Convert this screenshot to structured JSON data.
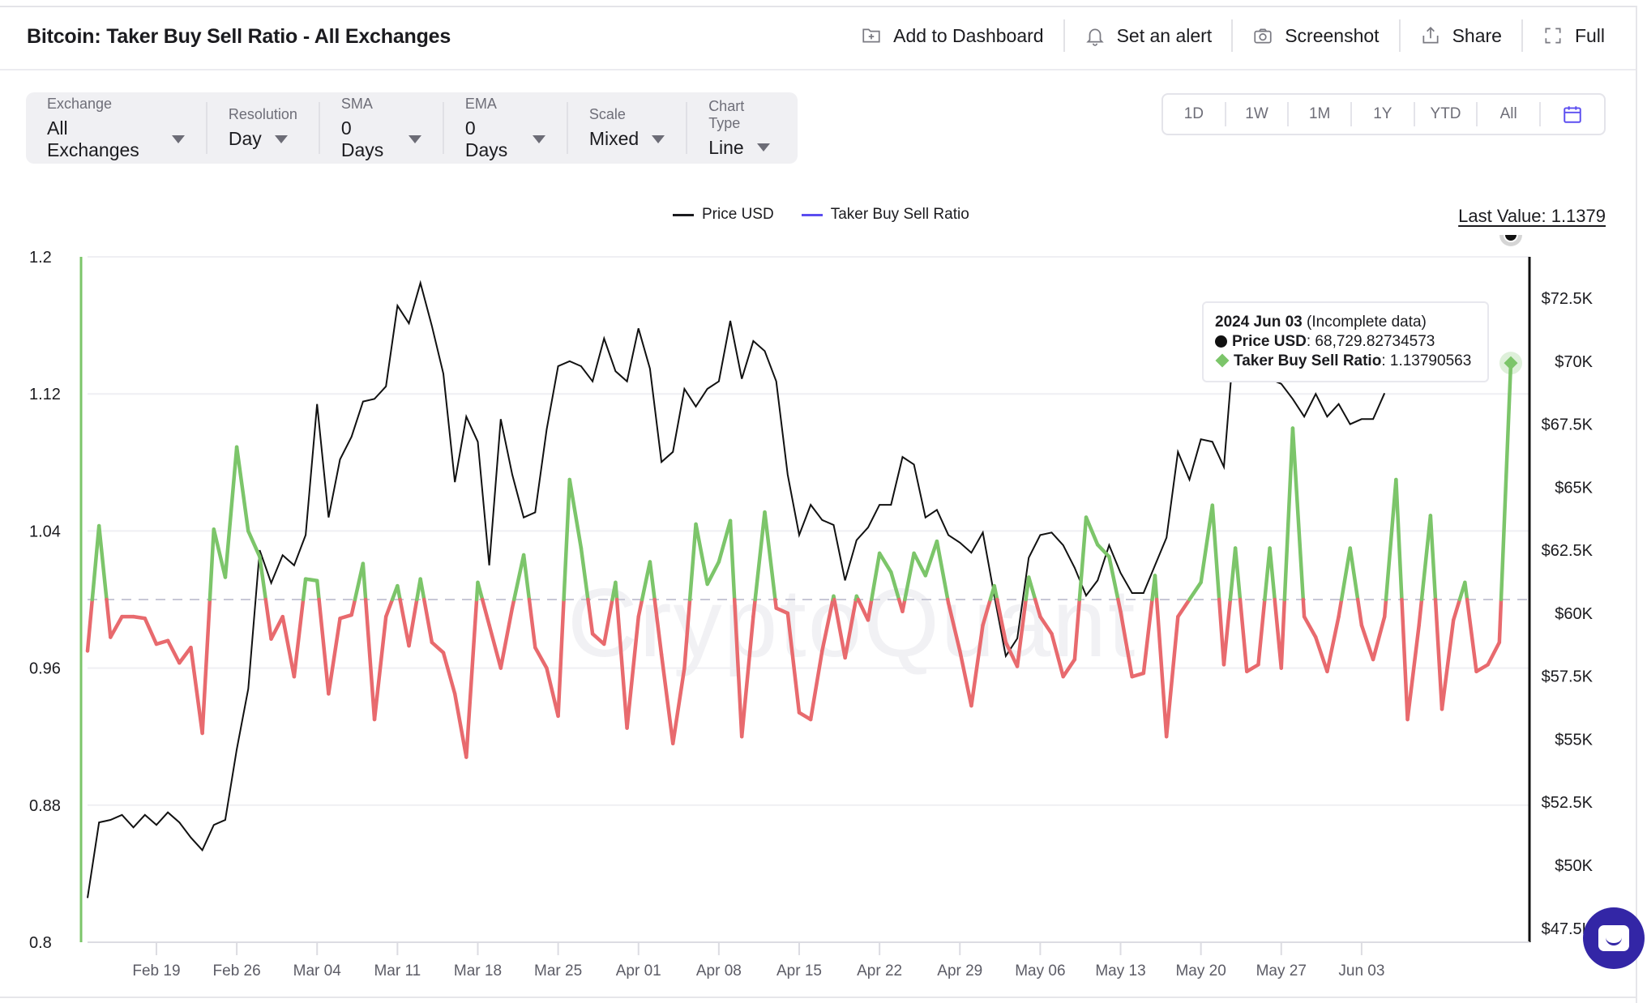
{
  "header": {
    "title": "Bitcoin: Taker Buy Sell Ratio - All Exchanges",
    "actions": [
      {
        "label": "Add to Dashboard",
        "icon": "folder-plus-icon"
      },
      {
        "label": "Set an alert",
        "icon": "bell-icon"
      },
      {
        "label": "Screenshot",
        "icon": "camera-icon"
      },
      {
        "label": "Share",
        "icon": "share-icon"
      },
      {
        "label": "Full",
        "icon": "fullscreen-icon"
      }
    ]
  },
  "filters": [
    {
      "label": "Exchange",
      "value": "All Exchanges"
    },
    {
      "label": "Resolution",
      "value": "Day"
    },
    {
      "label": "SMA",
      "value": "0 Days"
    },
    {
      "label": "EMA",
      "value": "0 Days"
    },
    {
      "label": "Scale",
      "value": "Mixed"
    },
    {
      "label": "Chart Type",
      "value": "Line"
    }
  ],
  "ranges": [
    "1D",
    "1W",
    "1M",
    "1Y",
    "YTD",
    "All"
  ],
  "range_calendar_icon": "calendar-icon",
  "legend": [
    {
      "label": "Price USD",
      "color": "#1b1b1f"
    },
    {
      "label": "Taker Buy Sell Ratio",
      "color": "#5b4df0"
    }
  ],
  "last_value": "Last Value: 1.1379",
  "tooltip": {
    "date": "2024 Jun 03",
    "note": " (Incomplete data)",
    "price_label": "Price USD",
    "price_value": ": 68,729.82734573",
    "ratio_label": "Taker Buy Sell Ratio",
    "ratio_value": ": 1.13790563"
  },
  "watermark": "CryptoQuant",
  "colors": {
    "above": "#7cc56a",
    "below": "#e86a6e",
    "price": "#111111",
    "reference": "#c8c8d6",
    "accent": "#5b4df0"
  },
  "chart_data": {
    "type": "line",
    "title": "Bitcoin: Taker Buy Sell Ratio - All Exchanges",
    "x_start": "2024-02-13",
    "x_end": "2024-06-03",
    "x_ticks": [
      "Feb 19",
      "Feb 26",
      "Mar 04",
      "Mar 11",
      "Mar 18",
      "Mar 25",
      "Apr 01",
      "Apr 08",
      "Apr 15",
      "Apr 22",
      "Apr 29",
      "May 06",
      "May 13",
      "May 20",
      "May 27",
      "Jun 03"
    ],
    "y_left": {
      "label": "Taker Buy Sell Ratio",
      "range": [
        0.8,
        1.2
      ],
      "ticks": [
        "0.8",
        "0.88",
        "0.96",
        "1.04",
        "1.12",
        "1.2"
      ],
      "reference": 1.0
    },
    "y_right": {
      "label": "Price USD",
      "range": [
        47500,
        75000
      ],
      "ticks": [
        "$47.5K",
        "$50K",
        "$52.5K",
        "$55K",
        "$57.5K",
        "$60K",
        "$62.5K",
        "$65K",
        "$67.5K",
        "$70K",
        "$72.5K"
      ]
    },
    "grid": true,
    "legend_position": "top-center",
    "series": [
      {
        "name": "Taker Buy Sell Ratio",
        "axis": "left",
        "values": [
          0.97,
          1.043,
          0.978,
          0.99,
          0.99,
          0.989,
          0.974,
          0.976,
          0.963,
          0.972,
          0.922,
          1.041,
          1.013,
          1.089,
          1.04,
          1.025,
          0.977,
          0.99,
          0.955,
          1.012,
          1.011,
          0.945,
          0.989,
          0.991,
          1.021,
          0.93,
          0.99,
          1.008,
          0.973,
          1.012,
          0.975,
          0.969,
          0.945,
          0.908,
          1.01,
          0.985,
          0.96,
          0.995,
          1.026,
          0.972,
          0.96,
          0.932,
          1.07,
          1.03,
          0.98,
          0.974,
          1.01,
          0.925,
          0.99,
          1.022,
          0.968,
          0.916,
          0.96,
          1.044,
          1.009,
          1.022,
          1.046,
          0.92,
          0.99,
          1.051,
          0.995,
          0.992,
          0.934,
          0.93,
          0.97,
          1.002,
          0.966,
          1.002,
          0.988,
          1.027,
          1.016,
          0.993,
          1.027,
          1.014,
          1.034,
          0.998,
          0.97,
          0.938,
          0.985,
          1.008,
          0.975,
          0.961,
          1.013,
          0.99,
          0.98,
          0.955,
          0.965,
          1.048,
          1.032,
          1.025,
          0.993,
          0.955,
          0.957,
          1.014,
          0.92,
          0.99,
          1.0,
          1.01,
          1.055,
          0.962,
          1.03,
          0.958,
          0.962,
          1.03,
          0.96,
          1.1,
          0.99,
          0.978,
          0.958,
          0.99,
          1.03,
          0.985,
          0.965,
          0.99,
          1.07,
          0.93,
          0.985,
          1.049,
          0.936,
          0.988,
          1.01,
          0.958,
          0.962,
          0.975,
          1.138
        ],
        "colors": {
          "above_1": "#7cc56a",
          "below_1": "#e86a6e"
        }
      },
      {
        "name": "Price USD",
        "axis": "right",
        "values": [
          48700,
          51700,
          51800,
          52000,
          51500,
          52000,
          51600,
          52100,
          51700,
          51100,
          50600,
          51600,
          51800,
          54600,
          57000,
          62500,
          61200,
          62300,
          61900,
          63100,
          68300,
          63800,
          66100,
          67000,
          68400,
          68500,
          69000,
          72200,
          71500,
          73100,
          71400,
          69500,
          65200,
          67800,
          66800,
          61900,
          67700,
          65500,
          63800,
          64000,
          67300,
          69800,
          70000,
          69800,
          69200,
          70900,
          69600,
          69200,
          71300,
          69700,
          66000,
          66400,
          68900,
          68200,
          68900,
          69200,
          71600,
          69300,
          70800,
          70400,
          69200,
          65500,
          63100,
          64300,
          63700,
          63500,
          61300,
          62900,
          63400,
          64300,
          64300,
          66200,
          65900,
          63800,
          64100,
          63100,
          62800,
          62400,
          63200,
          60700,
          58300,
          59000,
          62200,
          63100,
          63200,
          62700,
          61800,
          60700,
          61300,
          62700,
          61600,
          60800,
          60800,
          61900,
          63000,
          66400,
          65300,
          66900,
          66800,
          65800,
          71400,
          69800,
          70900,
          69300,
          69100,
          68500,
          67800,
          68700,
          67800,
          68300,
          67500,
          67700,
          67700,
          68730
        ]
      }
    ]
  }
}
